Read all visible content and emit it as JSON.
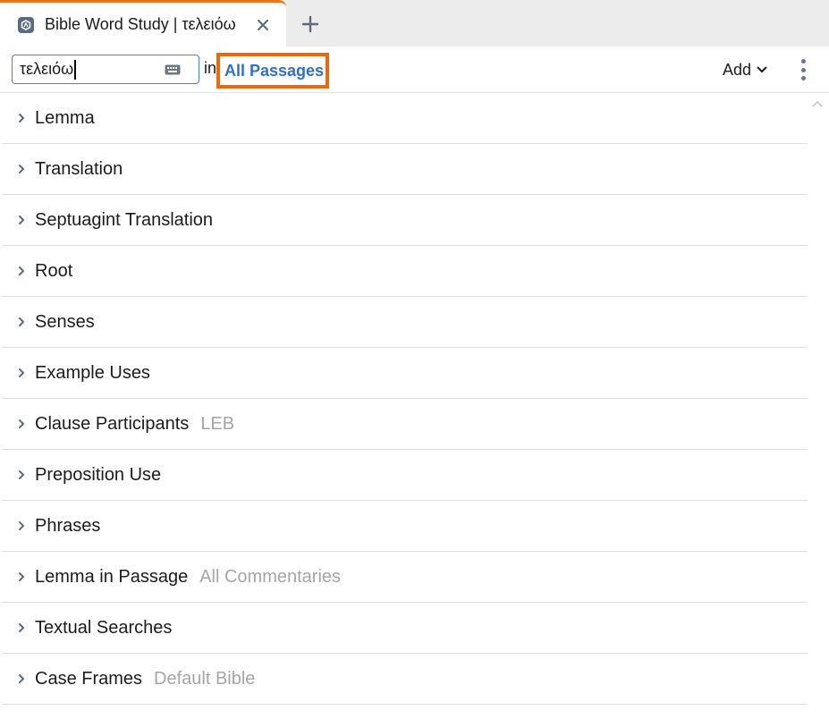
{
  "tab": {
    "title": "Bible Word Study | τελειόω",
    "icon": "logos-app-icon",
    "close_icon": "close-icon",
    "new_tab_icon": "plus-icon"
  },
  "toolbar": {
    "search_value": "τελειόω",
    "keyboard_icon": "keyboard-icon",
    "in_label": "in",
    "range_link": "All Passages",
    "add_label": "Add",
    "more_icon": "vertical-dots-icon"
  },
  "sections": [
    {
      "label": "Lemma",
      "sub": ""
    },
    {
      "label": "Translation",
      "sub": ""
    },
    {
      "label": "Septuagint Translation",
      "sub": ""
    },
    {
      "label": "Root",
      "sub": ""
    },
    {
      "label": "Senses",
      "sub": ""
    },
    {
      "label": "Example Uses",
      "sub": ""
    },
    {
      "label": "Clause Participants",
      "sub": "LEB"
    },
    {
      "label": "Preposition Use",
      "sub": ""
    },
    {
      "label": "Phrases",
      "sub": ""
    },
    {
      "label": "Lemma in Passage",
      "sub": "All Commentaries"
    },
    {
      "label": "Textual Searches",
      "sub": ""
    },
    {
      "label": "Case Frames",
      "sub": "Default Bible"
    }
  ],
  "colors": {
    "accent_orange": "#ea6a0a",
    "link_blue": "#2f6fd0",
    "muted_text": "#a5a5a5"
  }
}
